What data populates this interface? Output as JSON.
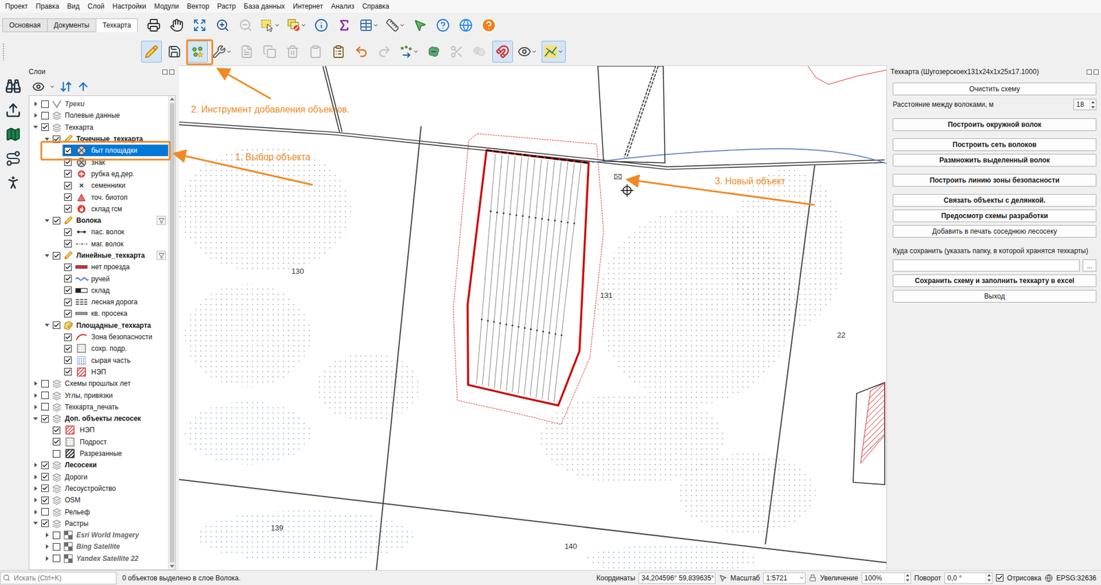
{
  "menu": [
    "Проект",
    "Правка",
    "Вид",
    "Слой",
    "Настройки",
    "Модули",
    "Вектор",
    "Растр",
    "База данных",
    "Интернет",
    "Анализ",
    "Справка"
  ],
  "toolbar_tabs": [
    {
      "label": "Основная",
      "selected": false
    },
    {
      "label": "Документы",
      "selected": false
    },
    {
      "label": "Техкарта",
      "selected": true
    }
  ],
  "toolbar_main": [
    {
      "kind": "print",
      "active": false,
      "disabled": false,
      "dropdown": false
    },
    {
      "kind": "pan",
      "active": false,
      "disabled": false,
      "dropdown": false
    },
    {
      "kind": "zoom-full",
      "active": false,
      "disabled": false,
      "dropdown": false
    },
    {
      "kind": "zoom-in",
      "active": false,
      "disabled": false,
      "dropdown": false
    },
    {
      "kind": "zoom-out",
      "active": false,
      "disabled": true,
      "dropdown": false
    },
    {
      "kind": "select",
      "active": false,
      "disabled": false,
      "dropdown": true
    },
    {
      "kind": "deselect",
      "active": false,
      "disabled": false,
      "dropdown": true
    },
    {
      "kind": "identify",
      "active": false,
      "disabled": false,
      "dropdown": false
    },
    {
      "kind": "statistics",
      "active": false,
      "disabled": false,
      "dropdown": false
    },
    {
      "kind": "attribute-table",
      "active": false,
      "disabled": false,
      "dropdown": true
    },
    {
      "kind": "measure",
      "active": false,
      "disabled": false,
      "dropdown": true
    },
    {
      "kind": "cursor",
      "active": false,
      "disabled": false,
      "dropdown": false
    },
    {
      "kind": "help",
      "active": false,
      "disabled": false,
      "dropdown": false
    },
    {
      "kind": "web",
      "active": false,
      "disabled": false,
      "dropdown": false
    },
    {
      "kind": "about",
      "active": false,
      "disabled": false,
      "dropdown": false
    }
  ],
  "toolbar_edit": [
    {
      "kind": "edit",
      "active": true,
      "disabled": false,
      "dropdown": false
    },
    {
      "kind": "save",
      "active": false,
      "disabled": false,
      "dropdown": false
    },
    {
      "kind": "add-point",
      "active": true,
      "disabled": false,
      "dropdown": false
    },
    {
      "kind": "vertex",
      "active": false,
      "disabled": false,
      "dropdown": true
    },
    {
      "kind": "edit-attributes",
      "active": false,
      "disabled": true,
      "dropdown": false
    },
    {
      "kind": "copy",
      "active": false,
      "disabled": true,
      "dropdown": false
    },
    {
      "kind": "delete",
      "active": false,
      "disabled": true,
      "dropdown": false
    },
    {
      "kind": "cut",
      "active": false,
      "disabled": true,
      "dropdown": false
    },
    {
      "kind": "paste",
      "active": false,
      "disabled": false,
      "dropdown": false
    },
    {
      "kind": "undo",
      "active": false,
      "disabled": false,
      "dropdown": false
    },
    {
      "kind": "redo",
      "active": false,
      "disabled": true,
      "dropdown": false
    },
    {
      "kind": "digitize",
      "active": false,
      "disabled": false,
      "dropdown": true
    },
    {
      "kind": "reshape",
      "active": false,
      "disabled": false,
      "dropdown": false
    },
    {
      "kind": "split",
      "active": false,
      "disabled": true,
      "dropdown": false
    },
    {
      "kind": "merge",
      "active": false,
      "disabled": true,
      "dropdown": false
    },
    {
      "kind": "snapping",
      "active": true,
      "disabled": false,
      "dropdown": false
    },
    {
      "kind": "snap-layers",
      "active": false,
      "disabled": false,
      "dropdown": true
    },
    {
      "kind": "tracing",
      "active": true,
      "disabled": false,
      "dropdown": true
    }
  ],
  "side_tools": [
    {
      "kind": "binoculars"
    },
    {
      "kind": "upload"
    },
    {
      "kind": "map"
    },
    {
      "kind": "route"
    },
    {
      "kind": "person"
    }
  ],
  "layers_panel": {
    "title": "Слои",
    "items": [
      {
        "label": "Треки",
        "level": 0,
        "kind": "track",
        "checked": false,
        "expanded": false,
        "bold": true,
        "italic": true,
        "selected": false,
        "filter": false
      },
      {
        "label": "Полевые данные",
        "level": 0,
        "kind": "group",
        "checked": false,
        "expanded": false,
        "bold": false,
        "italic": false,
        "selected": false,
        "filter": false
      },
      {
        "label": "Техкарта",
        "level": 0,
        "kind": "group",
        "checked": true,
        "expanded": true,
        "bold": false,
        "italic": false,
        "selected": false,
        "filter": false
      },
      {
        "label": "Точечные_техкарта",
        "level": 1,
        "kind": "edit-layer",
        "checked": true,
        "expanded": true,
        "bold": true,
        "italic": false,
        "selected": false,
        "filter": false
      },
      {
        "label": "быт площадки",
        "level": 2,
        "kind": "sym-circle-x",
        "checked": true,
        "expanded": false,
        "bold": false,
        "italic": false,
        "selected": true,
        "filter": false
      },
      {
        "label": "знак",
        "level": 2,
        "kind": "sym-circle-x",
        "checked": true,
        "expanded": false,
        "bold": false,
        "italic": false,
        "selected": false,
        "filter": false
      },
      {
        "label": "рубка ед.дер.",
        "level": 2,
        "kind": "sym-plus-circle",
        "checked": true,
        "expanded": false,
        "bold": false,
        "italic": false,
        "selected": false,
        "filter": false
      },
      {
        "label": "семенники",
        "level": 2,
        "kind": "sym-x",
        "checked": true,
        "expanded": false,
        "bold": false,
        "italic": false,
        "selected": false,
        "filter": false
      },
      {
        "label": "точ. биотоп",
        "level": 2,
        "kind": "sym-triangle",
        "checked": true,
        "expanded": false,
        "bold": false,
        "italic": false,
        "selected": false,
        "filter": false
      },
      {
        "label": "склад гсм",
        "level": 2,
        "kind": "sym-fire",
        "checked": true,
        "expanded": false,
        "bold": false,
        "italic": false,
        "selected": false,
        "filter": false
      },
      {
        "label": "Волока",
        "level": 1,
        "kind": "edit-layer",
        "checked": true,
        "expanded": true,
        "bold": true,
        "italic": false,
        "selected": false,
        "filter": true
      },
      {
        "label": "пас. волок",
        "level": 2,
        "kind": "sym-arrow-line",
        "checked": true,
        "expanded": false,
        "bold": false,
        "italic": false,
        "selected": false,
        "filter": false
      },
      {
        "label": "маг. волок",
        "level": 2,
        "kind": "sym-dash-line",
        "checked": true,
        "expanded": false,
        "bold": false,
        "italic": false,
        "selected": false,
        "filter": false
      },
      {
        "label": "Линейные_техкарта",
        "level": 1,
        "kind": "edit-layer",
        "checked": true,
        "expanded": true,
        "bold": true,
        "italic": false,
        "selected": false,
        "filter": true
      },
      {
        "label": "нет проезда",
        "level": 2,
        "kind": "sym-red-line",
        "checked": true,
        "expanded": false,
        "bold": false,
        "italic": false,
        "selected": false,
        "filter": false
      },
      {
        "label": "ручей",
        "level": 2,
        "kind": "sym-wave-line",
        "checked": true,
        "expanded": false,
        "bold": false,
        "italic": false,
        "selected": false,
        "filter": false
      },
      {
        "label": "склад",
        "level": 2,
        "kind": "sym-block-line",
        "checked": true,
        "expanded": false,
        "bold": false,
        "italic": false,
        "selected": false,
        "filter": false
      },
      {
        "label": "лесная дорога",
        "level": 2,
        "kind": "sym-double-line",
        "checked": true,
        "expanded": false,
        "bold": false,
        "italic": false,
        "selected": false,
        "filter": false
      },
      {
        "label": "кв. просека",
        "level": 2,
        "kind": "sym-grey-line",
        "checked": true,
        "expanded": false,
        "bold": false,
        "italic": false,
        "selected": false,
        "filter": false
      },
      {
        "label": "Площадные_техкарта",
        "level": 1,
        "kind": "polygon-layer",
        "checked": true,
        "expanded": true,
        "bold": true,
        "italic": false,
        "selected": false,
        "filter": false
      },
      {
        "label": "Зона безопасности",
        "level": 2,
        "kind": "sym-red-curve",
        "checked": true,
        "expanded": false,
        "bold": false,
        "italic": false,
        "selected": false,
        "filter": false
      },
      {
        "label": "сохр. подр.",
        "level": 2,
        "kind": "sym-dot-box",
        "checked": true,
        "expanded": false,
        "bold": false,
        "italic": false,
        "selected": false,
        "filter": false
      },
      {
        "label": "сырая часть",
        "level": 2,
        "kind": "sym-blue-dots",
        "checked": true,
        "expanded": false,
        "bold": false,
        "italic": false,
        "selected": false,
        "filter": false
      },
      {
        "label": "НЭП",
        "level": 2,
        "kind": "sym-hatch-red",
        "checked": true,
        "expanded": false,
        "bold": false,
        "italic": false,
        "selected": false,
        "filter": false
      },
      {
        "label": "Схемы прошлых лет",
        "level": 0,
        "kind": "group",
        "checked": false,
        "expanded": false,
        "bold": false,
        "italic": false,
        "selected": false,
        "filter": false
      },
      {
        "label": "Углы, привязки",
        "level": 0,
        "kind": "group",
        "checked": false,
        "expanded": false,
        "bold": false,
        "italic": false,
        "selected": false,
        "filter": false
      },
      {
        "label": "Техкарта_печать",
        "level": 0,
        "kind": "group",
        "checked": false,
        "expanded": false,
        "bold": false,
        "italic": false,
        "selected": false,
        "filter": false
      },
      {
        "label": "Доп. объекты лесосек",
        "level": 0,
        "kind": "group",
        "checked": true,
        "expanded": true,
        "bold": true,
        "italic": false,
        "selected": false,
        "filter": false
      },
      {
        "label": "НЭП",
        "level": 1,
        "kind": "sym-hatch-red",
        "checked": true,
        "expanded": false,
        "bold": false,
        "italic": false,
        "selected": false,
        "filter": false
      },
      {
        "label": "Подрост",
        "level": 1,
        "kind": "sym-dot-box",
        "checked": true,
        "expanded": false,
        "bold": false,
        "italic": false,
        "selected": false,
        "filter": false
      },
      {
        "label": "Разрезанные",
        "level": 1,
        "kind": "sym-hatch-black",
        "checked": false,
        "expanded": false,
        "bold": false,
        "italic": false,
        "selected": false,
        "filter": false
      },
      {
        "label": "Лесосеки",
        "level": 0,
        "kind": "group",
        "checked": true,
        "expanded": false,
        "bold": true,
        "italic": false,
        "selected": false,
        "filter": false
      },
      {
        "label": "Дороги",
        "level": 0,
        "kind": "group",
        "checked": true,
        "expanded": false,
        "bold": false,
        "italic": false,
        "selected": false,
        "filter": false
      },
      {
        "label": "Лесоустройство",
        "level": 0,
        "kind": "group",
        "checked": true,
        "expanded": false,
        "bold": false,
        "italic": false,
        "selected": false,
        "filter": false
      },
      {
        "label": "OSM",
        "level": 0,
        "kind": "group",
        "checked": true,
        "expanded": false,
        "bold": false,
        "italic": false,
        "selected": false,
        "filter": false
      },
      {
        "label": "Рельеф",
        "level": 0,
        "kind": "group",
        "checked": false,
        "expanded": false,
        "bold": false,
        "italic": false,
        "selected": false,
        "filter": false
      },
      {
        "label": "Растры",
        "level": 0,
        "kind": "group",
        "checked": true,
        "expanded": true,
        "bold": false,
        "italic": false,
        "selected": false,
        "filter": false
      },
      {
        "label": "Esri World Imagery",
        "level": 1,
        "kind": "raster",
        "checked": false,
        "expanded": false,
        "bold": true,
        "italic": true,
        "selected": false,
        "filter": false
      },
      {
        "label": "Bing Satellite",
        "level": 1,
        "kind": "raster",
        "checked": false,
        "expanded": false,
        "bold": true,
        "italic": true,
        "selected": false,
        "filter": false
      },
      {
        "label": "Yandex Satellite 22",
        "level": 1,
        "kind": "raster",
        "checked": false,
        "expanded": false,
        "bold": true,
        "italic": true,
        "selected": false,
        "filter": false
      }
    ]
  },
  "map": {
    "labels": [
      {
        "text": "130"
      },
      {
        "text": "131"
      },
      {
        "text": "22"
      },
      {
        "text": "139"
      },
      {
        "text": "140"
      }
    ]
  },
  "annotations": [
    {
      "text": "1. Выбор объекта"
    },
    {
      "text": "2. Инструмент добавления объектов."
    },
    {
      "text": "3. Новый объект"
    }
  ],
  "plugin_panel": {
    "title": "Техкарта (Шугозерскоех131х24х1х25х17.1000)",
    "groups": [
      [
        {
          "kind": "button",
          "label": "Очистить схему",
          "bold": false,
          "value": ""
        },
        {
          "kind": "spin",
          "label": "Расстояние между волоками, м",
          "bold": false,
          "value": "18"
        }
      ],
      [
        {
          "kind": "button",
          "label": "Построить окружной волок",
          "bold": true,
          "value": ""
        }
      ],
      [
        {
          "kind": "button",
          "label": "Построить сеть волоков",
          "bold": true,
          "value": ""
        },
        {
          "kind": "button",
          "label": "Размножить выделенный волок",
          "bold": true,
          "value": ""
        }
      ],
      [
        {
          "kind": "button",
          "label": "Построить линию зоны безопасности",
          "bold": true,
          "value": ""
        }
      ],
      [
        {
          "kind": "button",
          "label": "Связать объекты с делянкой.",
          "bold": true,
          "value": ""
        },
        {
          "kind": "button",
          "label": "Предосмотр схемы разработки",
          "bold": true,
          "value": ""
        },
        {
          "kind": "button",
          "label": "Добавить в печать соседнюю лесосеку",
          "bold": false,
          "value": ""
        }
      ],
      [
        {
          "kind": "label",
          "label": "Куда сохранить (указать папку, в которой хранятся техкарты)",
          "bold": false,
          "value": ""
        },
        {
          "kind": "path",
          "label": "...",
          "bold": false,
          "value": ""
        },
        {
          "kind": "button",
          "label": "Сохранить схему и заполнить техкарту в excel",
          "bold": true,
          "value": ""
        },
        {
          "kind": "button",
          "label": "Выход",
          "bold": false,
          "value": ""
        }
      ]
    ]
  },
  "status_bar": {
    "search_placeholder": "Искать (Ctrl+K)",
    "message": "0 объектов выделено в слое Волока.",
    "coords_label": "Координаты",
    "coords": "34,204596° 59,839635°",
    "scale_label": "Масштаб",
    "scale": "1:5721",
    "magnifier_label": "Увеличение",
    "magnifier": "100%",
    "rotation_label": "Поворот",
    "rotation": "0,0 °",
    "render_label": "Отрисовка",
    "render_checked": true,
    "crs": "EPSG:32636"
  }
}
